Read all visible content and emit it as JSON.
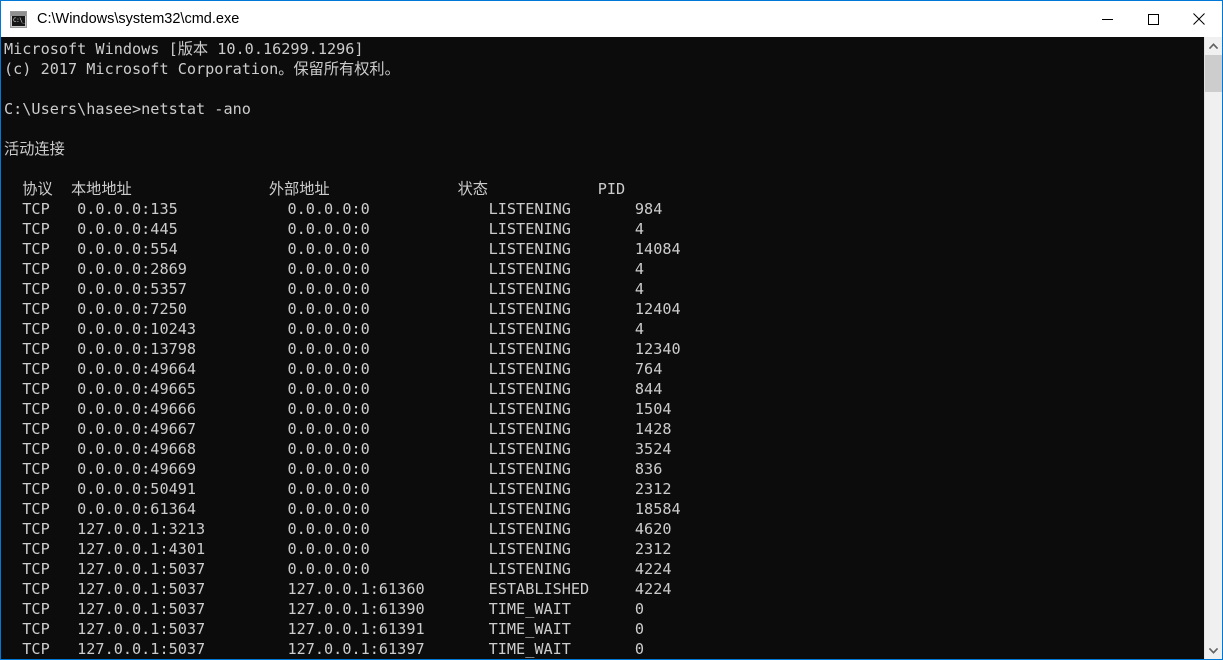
{
  "window": {
    "title": "C:\\Windows\\system32\\cmd.exe",
    "icon": "cmd-icon",
    "icon_glyph": "C:\\_",
    "accent_color": "#0078d7",
    "titlebar_bg": "#ffffff",
    "console_bg": "#0c0c0c",
    "console_fg": "#cccccc",
    "controls": {
      "minimize_label": "Minimize",
      "maximize_label": "Maximize",
      "close_label": "Close"
    }
  },
  "scrollbar": {
    "up_arrow_label": "Scroll up",
    "down_arrow_label": "Scroll down",
    "thumb_label": "Scroll thumb"
  },
  "console": {
    "banner_line_1": "Microsoft Windows [版本 10.0.16299.1296]",
    "banner_line_2": "(c) 2017 Microsoft Corporation。保留所有权利。",
    "prompt": "C:\\Users\\hasee>",
    "command": "netstat -ano",
    "section_title": "活动连接",
    "headers": {
      "proto": "协议",
      "local": "本地地址",
      "foreign": "外部地址",
      "state": "状态",
      "pid": "PID"
    },
    "rows": [
      {
        "proto": "TCP",
        "local": "0.0.0.0:135",
        "foreign": "0.0.0.0:0",
        "state": "LISTENING",
        "pid": "984"
      },
      {
        "proto": "TCP",
        "local": "0.0.0.0:445",
        "foreign": "0.0.0.0:0",
        "state": "LISTENING",
        "pid": "4"
      },
      {
        "proto": "TCP",
        "local": "0.0.0.0:554",
        "foreign": "0.0.0.0:0",
        "state": "LISTENING",
        "pid": "14084"
      },
      {
        "proto": "TCP",
        "local": "0.0.0.0:2869",
        "foreign": "0.0.0.0:0",
        "state": "LISTENING",
        "pid": "4"
      },
      {
        "proto": "TCP",
        "local": "0.0.0.0:5357",
        "foreign": "0.0.0.0:0",
        "state": "LISTENING",
        "pid": "4"
      },
      {
        "proto": "TCP",
        "local": "0.0.0.0:7250",
        "foreign": "0.0.0.0:0",
        "state": "LISTENING",
        "pid": "12404"
      },
      {
        "proto": "TCP",
        "local": "0.0.0.0:10243",
        "foreign": "0.0.0.0:0",
        "state": "LISTENING",
        "pid": "4"
      },
      {
        "proto": "TCP",
        "local": "0.0.0.0:13798",
        "foreign": "0.0.0.0:0",
        "state": "LISTENING",
        "pid": "12340"
      },
      {
        "proto": "TCP",
        "local": "0.0.0.0:49664",
        "foreign": "0.0.0.0:0",
        "state": "LISTENING",
        "pid": "764"
      },
      {
        "proto": "TCP",
        "local": "0.0.0.0:49665",
        "foreign": "0.0.0.0:0",
        "state": "LISTENING",
        "pid": "844"
      },
      {
        "proto": "TCP",
        "local": "0.0.0.0:49666",
        "foreign": "0.0.0.0:0",
        "state": "LISTENING",
        "pid": "1504"
      },
      {
        "proto": "TCP",
        "local": "0.0.0.0:49667",
        "foreign": "0.0.0.0:0",
        "state": "LISTENING",
        "pid": "1428"
      },
      {
        "proto": "TCP",
        "local": "0.0.0.0:49668",
        "foreign": "0.0.0.0:0",
        "state": "LISTENING",
        "pid": "3524"
      },
      {
        "proto": "TCP",
        "local": "0.0.0.0:49669",
        "foreign": "0.0.0.0:0",
        "state": "LISTENING",
        "pid": "836"
      },
      {
        "proto": "TCP",
        "local": "0.0.0.0:50491",
        "foreign": "0.0.0.0:0",
        "state": "LISTENING",
        "pid": "2312"
      },
      {
        "proto": "TCP",
        "local": "0.0.0.0:61364",
        "foreign": "0.0.0.0:0",
        "state": "LISTENING",
        "pid": "18584"
      },
      {
        "proto": "TCP",
        "local": "127.0.0.1:3213",
        "foreign": "0.0.0.0:0",
        "state": "LISTENING",
        "pid": "4620"
      },
      {
        "proto": "TCP",
        "local": "127.0.0.1:4301",
        "foreign": "0.0.0.0:0",
        "state": "LISTENING",
        "pid": "2312"
      },
      {
        "proto": "TCP",
        "local": "127.0.0.1:5037",
        "foreign": "0.0.0.0:0",
        "state": "LISTENING",
        "pid": "4224"
      },
      {
        "proto": "TCP",
        "local": "127.0.0.1:5037",
        "foreign": "127.0.0.1:61360",
        "state": "ESTABLISHED",
        "pid": "4224"
      },
      {
        "proto": "TCP",
        "local": "127.0.0.1:5037",
        "foreign": "127.0.0.1:61390",
        "state": "TIME_WAIT",
        "pid": "0"
      },
      {
        "proto": "TCP",
        "local": "127.0.0.1:5037",
        "foreign": "127.0.0.1:61391",
        "state": "TIME_WAIT",
        "pid": "0"
      },
      {
        "proto": "TCP",
        "local": "127.0.0.1:5037",
        "foreign": "127.0.0.1:61397",
        "state": "TIME_WAIT",
        "pid": "0"
      }
    ]
  }
}
